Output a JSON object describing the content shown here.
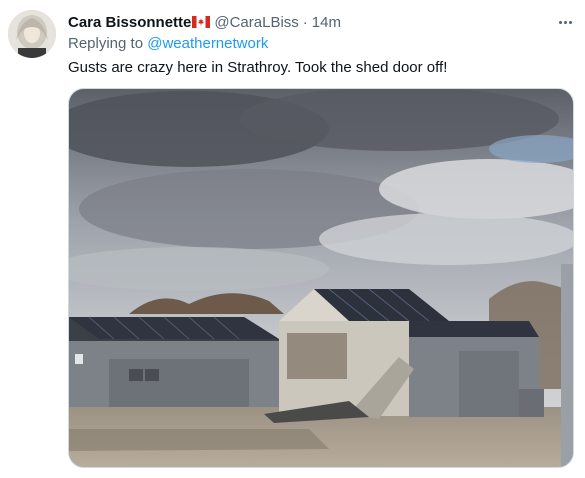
{
  "tweet": {
    "display_name": "Cara Bissonnette",
    "flag_icon": "canada-flag-icon",
    "handle": "@CaraLBiss",
    "separator": "·",
    "time": "14m",
    "replying_prefix": "Replying to",
    "replying_to": "@weathernetwork",
    "text": "Gusts are crazy here in Strathroy. Took the shed door off!",
    "more_icon": "more-options-icon",
    "media_icon": "photo"
  },
  "colors": {
    "link": "#1d9bf0",
    "secondary_text": "#536471",
    "primary_text": "#0f1419"
  }
}
